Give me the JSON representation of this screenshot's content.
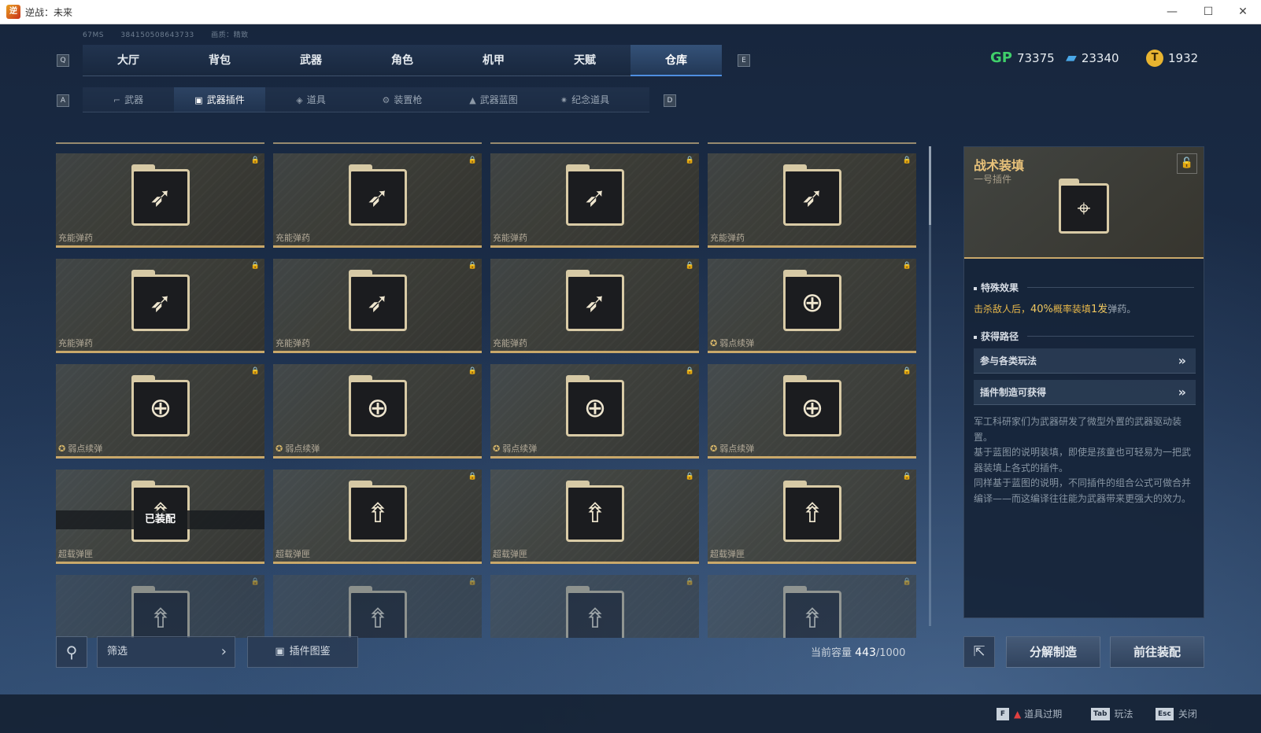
{
  "window": {
    "title": "逆战：未来",
    "minimize": "—",
    "maximize": "☐",
    "close": "✕"
  },
  "debug": {
    "ping": "67MS",
    "id": "384150508643733",
    "quality": "画质：精致"
  },
  "keys": {
    "prev_main": "Q",
    "next_main": "E",
    "prev_sub": "A",
    "next_sub": "D"
  },
  "main_nav": {
    "tabs": [
      "大厅",
      "背包",
      "武器",
      "角色",
      "机甲",
      "天赋",
      "仓库"
    ],
    "active_index": 6
  },
  "currency": {
    "gp": {
      "icon": "GP",
      "value": "73375"
    },
    "ticket": {
      "icon": "▰",
      "value": "23340"
    },
    "coin": {
      "icon": "T",
      "value": "1932"
    }
  },
  "sub_nav": {
    "tabs": [
      {
        "icon": "⌐",
        "label": "武器"
      },
      {
        "icon": "▣",
        "label": "武器插件"
      },
      {
        "icon": "◈",
        "label": "道具"
      },
      {
        "icon": "⚙",
        "label": "装置枪"
      },
      {
        "icon": "▲",
        "label": "武器蓝图"
      },
      {
        "icon": "✷",
        "label": "纪念道具"
      }
    ],
    "active_index": 1
  },
  "items": [
    {
      "name": "充能弹药",
      "icon": "bullets-icon",
      "glyph": "➶",
      "equipped": false
    },
    {
      "name": "充能弹药",
      "icon": "bullets-icon",
      "glyph": "➶",
      "equipped": false
    },
    {
      "name": "充能弹药",
      "icon": "bullets-icon",
      "glyph": "➶",
      "equipped": false
    },
    {
      "name": "充能弹药",
      "icon": "bullets-icon",
      "glyph": "➶",
      "equipped": false
    },
    {
      "name": "充能弹药",
      "icon": "bullets-icon",
      "glyph": "➶",
      "equipped": false
    },
    {
      "name": "充能弹药",
      "icon": "bullets-icon",
      "glyph": "➶",
      "equipped": false
    },
    {
      "name": "充能弹药",
      "icon": "bullets-icon",
      "glyph": "➶",
      "equipped": false
    },
    {
      "name": "弱点续弹",
      "icon": "crosshair-icon",
      "glyph": "⊕",
      "equipped": false,
      "badge": true
    },
    {
      "name": "弱点续弹",
      "icon": "crosshair-icon",
      "glyph": "⊕",
      "equipped": false,
      "badge": true
    },
    {
      "name": "弱点续弹",
      "icon": "crosshair-icon",
      "glyph": "⊕",
      "equipped": false,
      "badge": true
    },
    {
      "name": "弱点续弹",
      "icon": "crosshair-icon",
      "glyph": "⊕",
      "equipped": false,
      "badge": true
    },
    {
      "name": "弱点续弹",
      "icon": "crosshair-icon",
      "glyph": "⊕",
      "equipped": false,
      "badge": true
    },
    {
      "name": "超载弹匣",
      "icon": "magazine-icon",
      "glyph": "⇮",
      "equipped": true,
      "equipped_label": "已装配"
    },
    {
      "name": "超载弹匣",
      "icon": "magazine-icon",
      "glyph": "⇮",
      "equipped": false
    },
    {
      "name": "超载弹匣",
      "icon": "magazine-icon",
      "glyph": "⇮",
      "equipped": false
    },
    {
      "name": "超载弹匣",
      "icon": "magazine-icon",
      "glyph": "⇮",
      "equipped": false
    }
  ],
  "bottom": {
    "filter_label": "筛选",
    "catalog_label": "插件图鉴",
    "capacity_label": "当前容量",
    "capacity_used": "443",
    "capacity_total": "/1000"
  },
  "detail": {
    "name": "战术装填",
    "subtitle": "一号插件",
    "effect_title": "特殊效果",
    "effect_prefix": "击杀敌人后，",
    "effect_pct": "40%",
    "effect_mid": "概率装填",
    "effect_count": "1发",
    "effect_suffix": "弹药。",
    "source_title": "获得路径",
    "sources": [
      "参与各类玩法",
      "插件制造可获得"
    ],
    "description": [
      "军工科研家们为武器研发了微型外置的武器驱动装置。",
      "基于蓝图的说明装填，即使是孩童也可轻易为一把武器装填上各式的插件。",
      "同样基于蓝图的说明，不同插件的组合公式可做合并编译——而这编译往往能为武器带来更强大的效力。"
    ],
    "btn_disassemble": "分解制造",
    "btn_equip": "前往装配"
  },
  "footer": {
    "hints": [
      {
        "key": "F",
        "label": "道具过期",
        "warn": true
      },
      {
        "key": "Tab",
        "label": "玩法"
      },
      {
        "key": "Esc",
        "label": "关闭"
      }
    ]
  }
}
